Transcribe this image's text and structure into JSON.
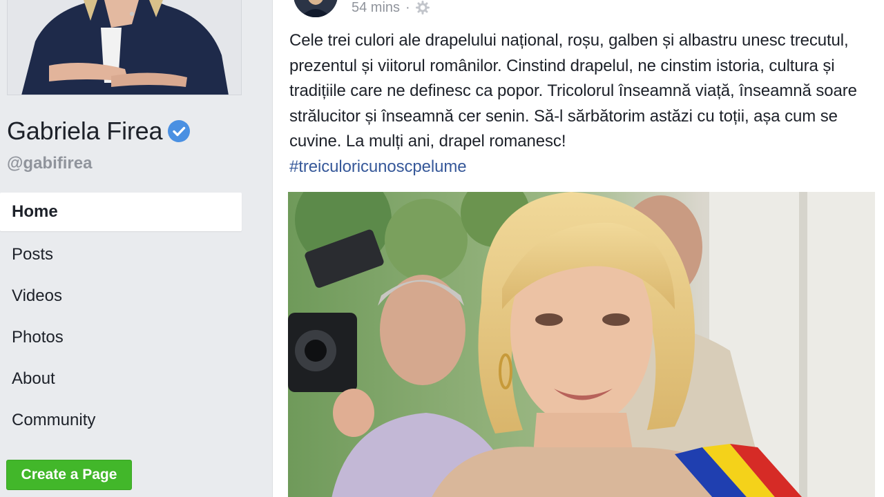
{
  "profile": {
    "name": "Gabriela Firea",
    "handle": "@gabifirea"
  },
  "nav": {
    "items": [
      {
        "label": "Home"
      },
      {
        "label": "Posts"
      },
      {
        "label": "Videos"
      },
      {
        "label": "Photos"
      },
      {
        "label": "About"
      },
      {
        "label": "Community"
      }
    ],
    "active": "Home"
  },
  "create_page": {
    "label": "Create a Page"
  },
  "post": {
    "time": "54 mins",
    "separator": "·",
    "privacy_icon": "globe-icon",
    "text": "Cele trei culori ale drapelului național, roșu, galben și albastru unesc trecutul, prezentul și viitorul românilor. Cinstind drapelul, ne cinstim istoria, cultura și tradițiile care ne definesc ca popor. Tricolorul înseamnă viață, înseamnă soare strălucitor și înseamnă cer senin. Să-l sărbătorim astăzi cu toții, așa cum se cuvine. La mulți ani, drapel romanesc!",
    "hashtag": "#treiculoricunoscpelume"
  },
  "colors": {
    "background": "#e9ebee",
    "link": "#365899",
    "create_button": "#42b72a",
    "verified": "#4a90e2",
    "muted_text": "#90949c"
  }
}
